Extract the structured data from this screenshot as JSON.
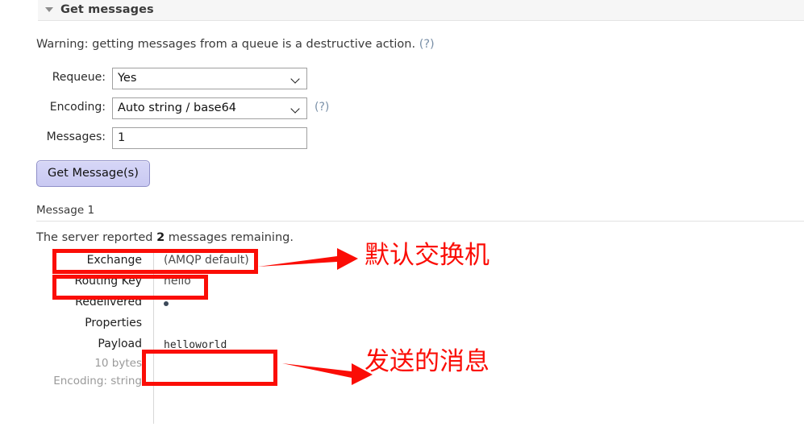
{
  "section": {
    "title": "Get messages",
    "caret_icon": "triangle-down-icon"
  },
  "warning": {
    "text": "Warning: getting messages from a queue is a destructive action.",
    "help_link": "(?)"
  },
  "form": {
    "rows": [
      {
        "label": "Requeue:",
        "value": "Yes",
        "type": "select",
        "suffix": ""
      },
      {
        "label": "Encoding:",
        "value": "Auto string / base64",
        "type": "select",
        "suffix": "(?)"
      },
      {
        "label": "Messages:",
        "value": "1",
        "type": "input",
        "suffix": ""
      }
    ],
    "submit_label": "Get Message(s)"
  },
  "result": {
    "message_heading": "Message 1",
    "report_prefix": "The server reported ",
    "report_count": "2",
    "report_suffix": " messages remaining.",
    "properties": [
      {
        "key": "Exchange",
        "value": "(AMQP default)",
        "sub": ""
      },
      {
        "key": "Routing Key",
        "value": "hello",
        "sub": ""
      },
      {
        "key": "Redelivered",
        "value": "",
        "sub": "",
        "marker": "dot"
      },
      {
        "key": "Properties",
        "value": "",
        "sub": ""
      },
      {
        "key": "Payload",
        "value": "helloworld",
        "sub": "10 bytes"
      },
      {
        "key": "",
        "value": "",
        "sub": "Encoding: string"
      }
    ]
  },
  "annotations": {
    "color": "#fb0d06",
    "labels": [
      {
        "text": "默认交换机"
      },
      {
        "text": "发送的消息"
      }
    ]
  }
}
